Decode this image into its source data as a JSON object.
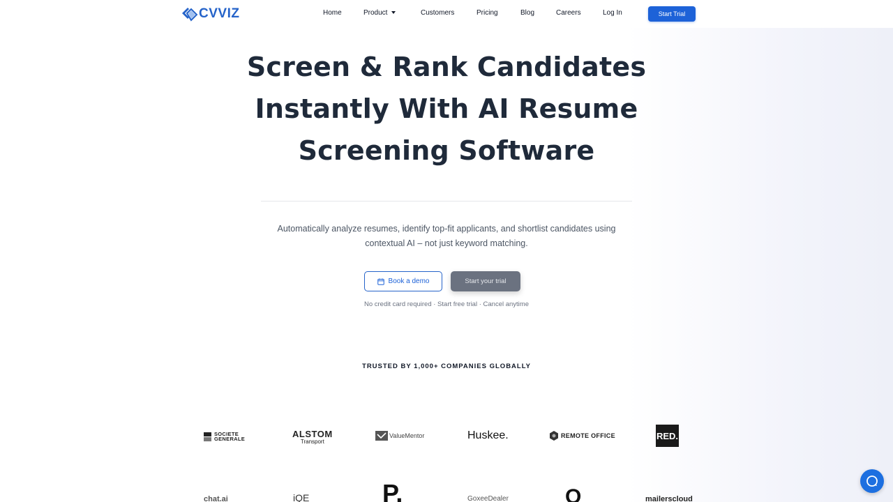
{
  "brand": {
    "name": "CVVIZ",
    "accent": "#1d62d8"
  },
  "nav": {
    "items": [
      {
        "label": "Home"
      },
      {
        "label": "Product"
      },
      {
        "label": "Customers"
      },
      {
        "label": "Pricing"
      },
      {
        "label": "Blog"
      },
      {
        "label": "Careers"
      },
      {
        "label": "Log In"
      }
    ],
    "cta": "Start Trial"
  },
  "hero": {
    "title_lines": [
      "Screen & Rank Candidates",
      "Instantly With AI Resume",
      "Screening Software"
    ],
    "subtitle_lines": [
      "Automatically analyze resumes, identify top-fit applicants, and shortlist candidates using",
      "contextual AI – not just keyword matching."
    ],
    "demo_button": "Book a demo",
    "trial_button": "Start your trial",
    "fine_print": "No credit card required · Start free trial · Cancel anytime"
  },
  "trusted": {
    "heading": "TRUSTED BY 1,000+ COMPANIES GLOBALLY",
    "logos_row1": [
      {
        "line1": "SOCIETE",
        "line2": "GENERALE"
      },
      {
        "line1": "ALSTOM",
        "line2": "Transport"
      },
      {
        "line1": "ValueMentor"
      },
      {
        "line1": "Huskee."
      },
      {
        "line1": "REMOTE OFFICE"
      },
      {
        "line1": "RED."
      }
    ],
    "logos_row2": [
      {
        "line1": "chat.ai"
      },
      {
        "line1": "iQE"
      },
      {
        "line1": "P."
      },
      {
        "line1": "GoxeeDealer"
      },
      {
        "line1": "O"
      },
      {
        "line1": "mailerscloud"
      }
    ]
  },
  "chat": {
    "icon": "chat-bubble-icon"
  }
}
